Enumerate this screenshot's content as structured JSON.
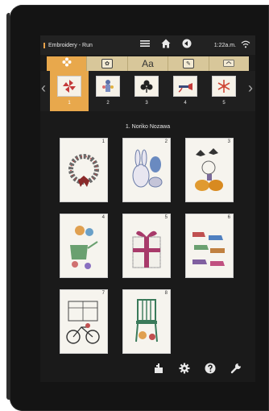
{
  "status_bar": {
    "title": "Embroidery - Run",
    "time": "1:22a.m.",
    "icons": [
      "menu-icon",
      "home-icon",
      "back-icon",
      "wifi-icon"
    ]
  },
  "tabs": [
    {
      "icon": "flower-settings-icon",
      "active": true
    },
    {
      "icon": "design-icon",
      "active": false
    },
    {
      "label": "Aa",
      "active": false
    },
    {
      "icon": "edit-design-icon",
      "active": false
    },
    {
      "icon": "folder-icon",
      "active": false
    }
  ],
  "carousel": {
    "items": [
      {
        "number": "1",
        "active": true
      },
      {
        "number": "2",
        "active": false
      },
      {
        "number": "3",
        "active": false
      },
      {
        "number": "4",
        "active": false
      },
      {
        "number": "5",
        "active": false
      }
    ]
  },
  "collection": {
    "title": "1. Noriko Nozawa",
    "designs": [
      {
        "number": "1"
      },
      {
        "number": "2"
      },
      {
        "number": "3"
      },
      {
        "number": "4"
      },
      {
        "number": "5"
      },
      {
        "number": "6"
      },
      {
        "number": "7"
      },
      {
        "number": "8"
      }
    ]
  },
  "bottom_toolbar": {
    "icons": [
      "machine-icon",
      "gear-icon",
      "help-icon",
      "wrench-icon"
    ]
  },
  "colors": {
    "accent": "#e8a84c",
    "tab_bg": "#d8c79a",
    "screen_bg": "#1a1a1a"
  }
}
